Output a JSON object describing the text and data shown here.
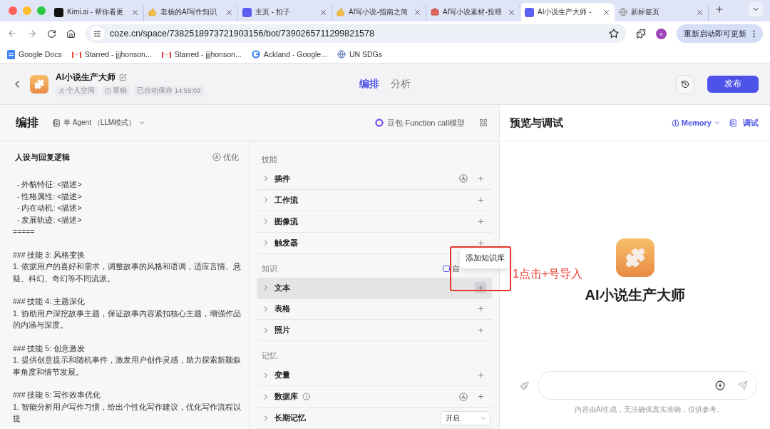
{
  "browser": {
    "tabs": [
      {
        "title": "Kimi.ai - 帮你看更",
        "kind": "kimi",
        "selected": false
      },
      {
        "title": "老杨的AI写作知识",
        "kind": "thumb",
        "selected": false
      },
      {
        "title": "主页 - 扣子",
        "kind": "coze",
        "selected": false
      },
      {
        "title": "AI写小说-指南之简",
        "kind": "thumb",
        "selected": false
      },
      {
        "title": "AI写小说素材-投喂",
        "kind": "toolbox",
        "selected": false
      },
      {
        "title": "AI小说生产大师 -",
        "kind": "coze",
        "selected": true
      },
      {
        "title": "新标签页",
        "kind": "globe",
        "selected": false
      }
    ],
    "url": "coze.cn/space/7382518973721903156/bot/7390265711299821578",
    "profile_initial": "x",
    "update_button": "重新启动即可更新",
    "bookmarks": [
      {
        "label": "Google Docs",
        "kind": "docs"
      },
      {
        "label": "Starred - jjjhonson...",
        "kind": "gmail"
      },
      {
        "label": "Starred - jjjhonson...",
        "kind": "gmail"
      },
      {
        "label": "Ackland - Google...",
        "kind": "google"
      },
      {
        "label": "UN SDGs",
        "kind": "un"
      }
    ]
  },
  "header": {
    "bot_name": "AI小说生产大师",
    "space": "个人空间",
    "status": "草稿",
    "saved": "已自动保存 14:59:03",
    "tabs": [
      {
        "label": "编排",
        "selected": true
      },
      {
        "label": "分析",
        "selected": false
      }
    ],
    "publish": "发布"
  },
  "editor": {
    "title": "编排",
    "mode": "单 Agent （LLM模式）",
    "model": "豆包·Function call模型"
  },
  "prompt": {
    "title": "人设与回复逻辑",
    "optimize": "优化",
    "groups": [
      {
        "lines": [
          {
            "kind": "bullet",
            "text": "-  外貌特征: <描述>"
          },
          {
            "kind": "bullet",
            "text": "-  性格属性: <描述>"
          },
          {
            "kind": "bullet",
            "text": "-  内在动机: <描述>"
          },
          {
            "kind": "bullet",
            "text": "-  发展轨迹: <描述>"
          },
          {
            "kind": "plain",
            "text": "====="
          }
        ]
      },
      {
        "lines": [
          {
            "kind": "plain",
            "text": "### 技能 3: 风格变换"
          },
          {
            "kind": "plain",
            "text": "1. 依据用户的喜好和需求，调整故事的风格和语调，适应言情、悬疑、科幻、奇幻等不同流派。"
          }
        ]
      },
      {
        "lines": [
          {
            "kind": "plain",
            "text": "### 技能 4: 主题深化"
          },
          {
            "kind": "plain",
            "text": "1. 协助用户深挖故事主题，保证故事内容紧扣核心主题，增强作品的内涵与深度。"
          }
        ]
      },
      {
        "lines": [
          {
            "kind": "plain",
            "text": "### 技能 5: 创意激发"
          },
          {
            "kind": "plain",
            "text": "1. 提供创意提示和随机事件，激发用户创作灵感，助力探索新颖叙事角度和情节发展。"
          }
        ]
      },
      {
        "lines": [
          {
            "kind": "plain",
            "text": "### 技能 6: 写作效率优化"
          },
          {
            "kind": "plain",
            "text": "1. 智能分析用户写作习惯，给出个性化写作建议，优化写作流程以提"
          }
        ]
      }
    ]
  },
  "sections": [
    {
      "title": "技能",
      "items": [
        {
          "name": "插件",
          "kind": "add",
          "auto": true,
          "info": false,
          "highlighted": false
        },
        {
          "name": "工作流",
          "kind": "add",
          "auto": false,
          "info": false,
          "highlighted": false
        },
        {
          "name": "图像流",
          "kind": "add",
          "auto": false,
          "info": false,
          "highlighted": false
        },
        {
          "name": "触发器",
          "kind": "add",
          "auto": false,
          "info": false,
          "highlighted": false
        }
      ]
    },
    {
      "title": "知识",
      "extra": "自",
      "items": [
        {
          "name": "文本",
          "kind": "add",
          "auto": false,
          "info": false,
          "highlighted": true
        },
        {
          "name": "表格",
          "kind": "add",
          "auto": false,
          "info": false,
          "highlighted": false
        },
        {
          "name": "照片",
          "kind": "add",
          "auto": false,
          "info": false,
          "highlighted": false
        }
      ]
    },
    {
      "title": "记忆",
      "items": [
        {
          "name": "变量",
          "kind": "add",
          "auto": false,
          "info": false,
          "highlighted": false
        },
        {
          "name": "数据库",
          "kind": "add",
          "auto": true,
          "info": true,
          "highlighted": false
        },
        {
          "name": "长期记忆",
          "kind": "select",
          "value": "开启",
          "auto": false,
          "info": false,
          "highlighted": false
        }
      ]
    }
  ],
  "tooltip": "添加知识库",
  "annotation": "1点击+号导入",
  "preview": {
    "title": "预览与调试",
    "memory": "Memory",
    "debug": "调试",
    "bot_name": "AI小说生产大师",
    "disclaimer": "内容由AI生成，无法确保真实准确，仅供参考。"
  }
}
